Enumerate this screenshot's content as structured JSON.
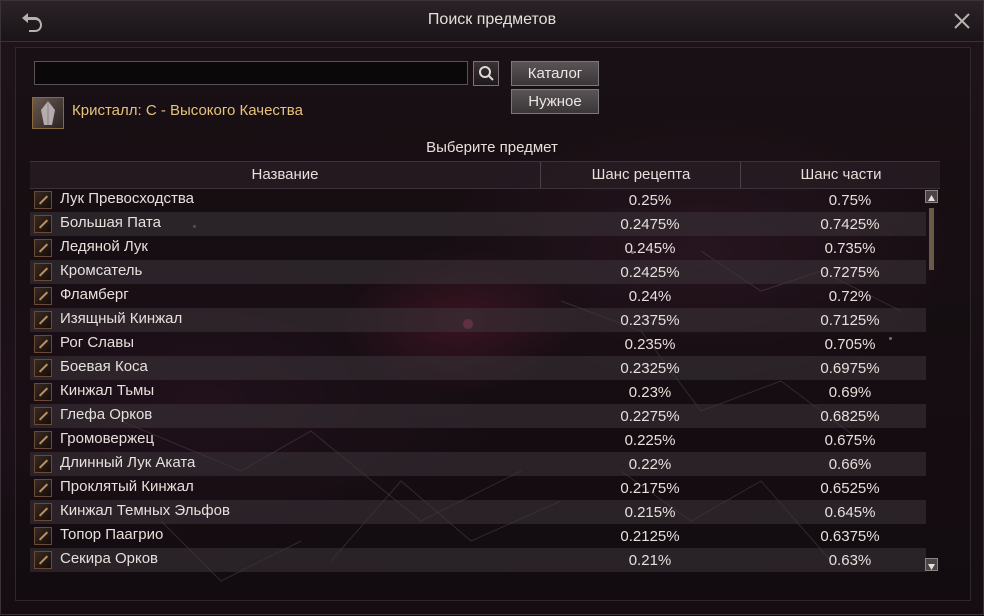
{
  "window": {
    "title": "Поиск предметов"
  },
  "search": {
    "value": "",
    "placeholder": ""
  },
  "tabs": {
    "catalog": "Каталог",
    "needed": "Нужное"
  },
  "selected_item": {
    "name": "Кристалл: C - Высокого Качества"
  },
  "list": {
    "caption": "Выберите предмет",
    "headers": {
      "name": "Название",
      "recipe": "Шанс рецепта",
      "part": "Шанс части"
    },
    "rows": [
      {
        "name": "Лук Превосходства",
        "recipe": "0.25%",
        "part": "0.75%"
      },
      {
        "name": "Большая Пата",
        "recipe": "0.2475%",
        "part": "0.7425%"
      },
      {
        "name": "Ледяной Лук",
        "recipe": "0.245%",
        "part": "0.735%"
      },
      {
        "name": "Кромсатель",
        "recipe": "0.2425%",
        "part": "0.7275%"
      },
      {
        "name": "Фламберг",
        "recipe": "0.24%",
        "part": "0.72%"
      },
      {
        "name": "Изящный Кинжал",
        "recipe": "0.2375%",
        "part": "0.7125%"
      },
      {
        "name": "Рог Славы",
        "recipe": "0.235%",
        "part": "0.705%"
      },
      {
        "name": "Боевая Коса",
        "recipe": "0.2325%",
        "part": "0.6975%"
      },
      {
        "name": "Кинжал Тьмы",
        "recipe": "0.23%",
        "part": "0.69%"
      },
      {
        "name": "Глефа Орков",
        "recipe": "0.2275%",
        "part": "0.6825%"
      },
      {
        "name": "Громовержец",
        "recipe": "0.225%",
        "part": "0.675%"
      },
      {
        "name": "Длинный Лук Аката",
        "recipe": "0.22%",
        "part": "0.66%"
      },
      {
        "name": "Проклятый Кинжал",
        "recipe": "0.2175%",
        "part": "0.6525%"
      },
      {
        "name": "Кинжал Темных Эльфов",
        "recipe": "0.215%",
        "part": "0.645%"
      },
      {
        "name": "Топор Паагрио",
        "recipe": "0.2125%",
        "part": "0.6375%"
      },
      {
        "name": "Секира Орков",
        "recipe": "0.21%",
        "part": "0.63%"
      }
    ]
  },
  "colors": {
    "item_name": "#e6c27a",
    "text": "#e6e0dc",
    "row_alt": "#3c343a"
  }
}
